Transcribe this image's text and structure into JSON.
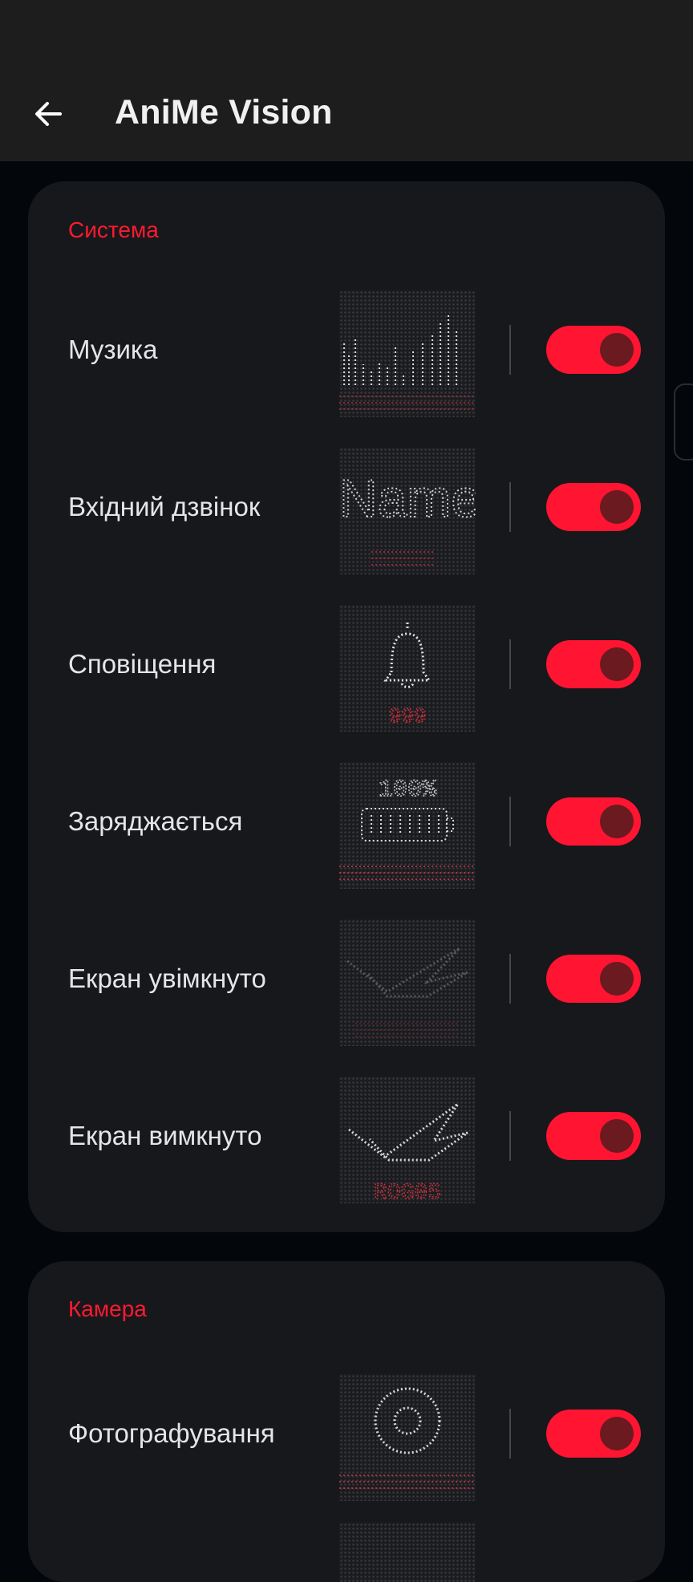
{
  "header": {
    "title": "AniMe Vision",
    "back_icon": "arrow-left-icon"
  },
  "sections": [
    {
      "title": "Система",
      "items": [
        {
          "label": "Музика",
          "enabled": true,
          "preview_text": ""
        },
        {
          "label": "Вхідний дзвінок",
          "enabled": true,
          "preview_text": "Name"
        },
        {
          "label": "Сповіщення",
          "enabled": true,
          "preview_text": "999"
        },
        {
          "label": "Заряджається",
          "enabled": true,
          "preview_text": "100%"
        },
        {
          "label": "Екран увімкнуто",
          "enabled": true,
          "preview_text": ""
        },
        {
          "label": "Екран вимкнуто",
          "enabled": true,
          "preview_text": "ROG05"
        }
      ]
    },
    {
      "title": "Камера",
      "items": [
        {
          "label": "Фотографування",
          "enabled": true,
          "preview_text": ""
        }
      ]
    }
  ],
  "colors": {
    "accent": "#ff1431",
    "section_title": "#ff1a2e",
    "card_bg": "#17181c",
    "page_bg": "#03060b",
    "topbar_bg": "#1d1d1d"
  }
}
